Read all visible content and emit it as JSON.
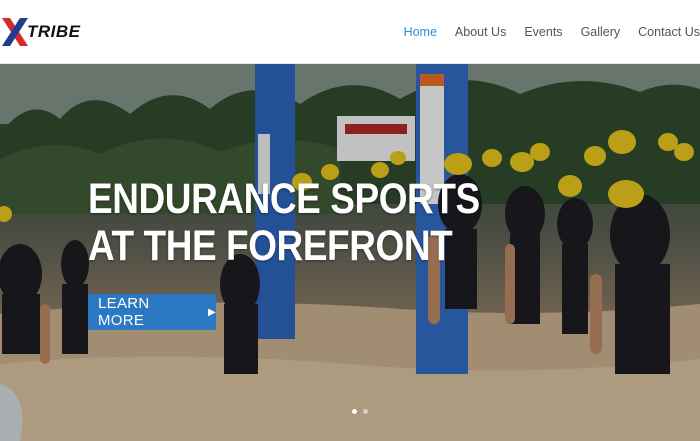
{
  "brand": {
    "logo_text": "TRIBE",
    "colors": {
      "x_red": "#d42a2a",
      "x_blue": "#1e3f8f"
    }
  },
  "nav": {
    "items": [
      {
        "label": "Home",
        "active": true
      },
      {
        "label": "About Us",
        "active": false
      },
      {
        "label": "Events",
        "active": false
      },
      {
        "label": "Gallery",
        "active": false
      },
      {
        "label": "Contact Us",
        "active": false
      }
    ],
    "active_color": "#2a8fd4"
  },
  "hero": {
    "title_line1": "ENDURANCE SPORTS",
    "title_line2": "AT THE FOREFRONT",
    "cta_label": "LEARN MORE",
    "cta_icon": "chevron-right-icon",
    "cta_color": "#2b79c2",
    "slides": 2,
    "active_slide": 1,
    "image_description_icon": "triathlon-swim-start-photo"
  }
}
